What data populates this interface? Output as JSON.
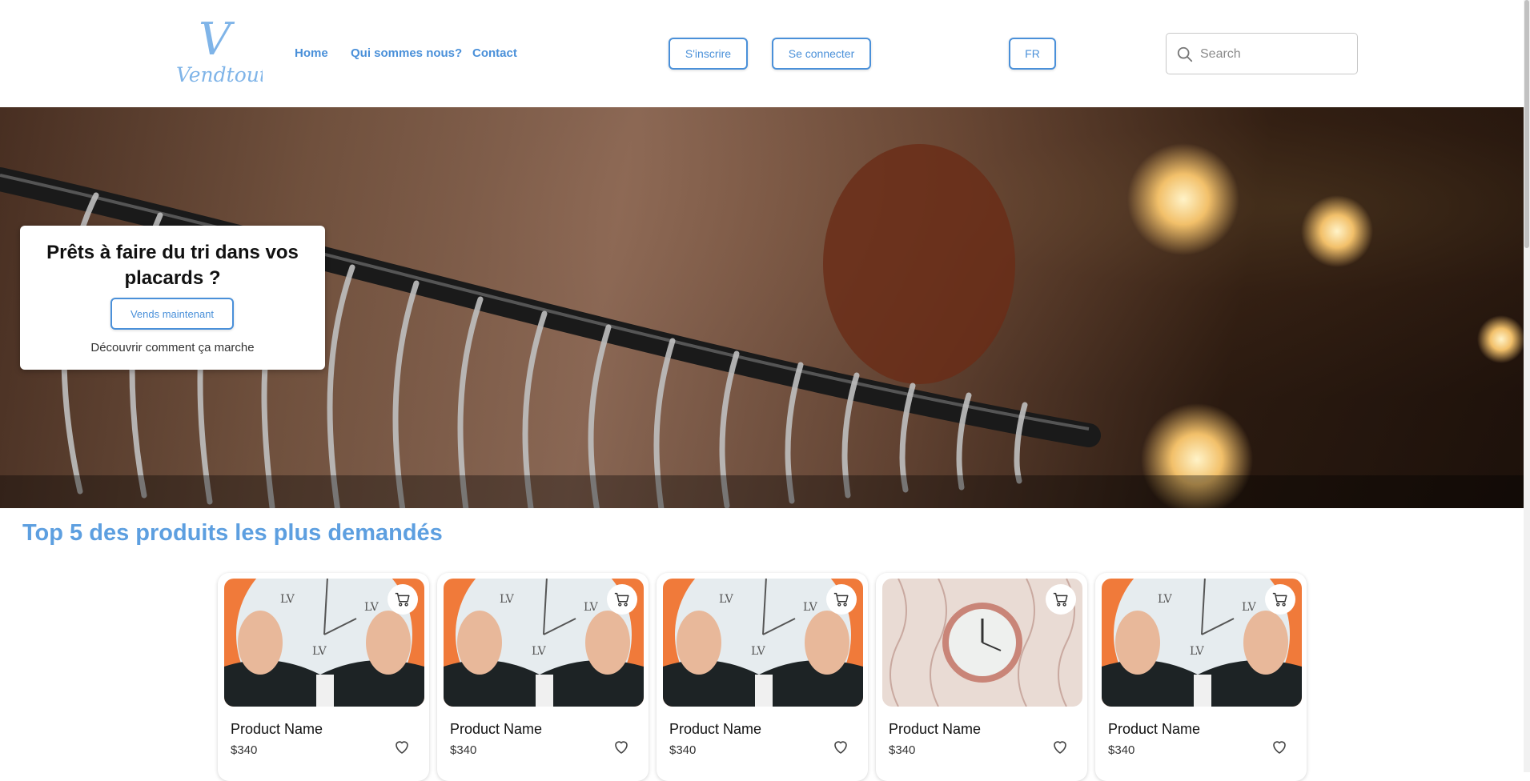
{
  "brand": {
    "logo_text": "Vendtout",
    "logo_letter": "V"
  },
  "nav": {
    "home": "Home",
    "about": "Qui sommes nous?",
    "contact": "Contact"
  },
  "auth": {
    "signup": "S'inscrire",
    "login": "Se connecter"
  },
  "language": "FR",
  "search": {
    "placeholder": "Search",
    "icon": "search-icon"
  },
  "hero": {
    "title": "Prêts à faire du tri dans vos placards ?",
    "cta": "Vends maintenant",
    "link": "Découvrir comment ça marche"
  },
  "section": {
    "title": "Top 5 des produits les plus demandés"
  },
  "products": [
    {
      "name": "Product Name",
      "price": "$340",
      "image": "clock-in-hands"
    },
    {
      "name": "Product Name",
      "price": "$340",
      "image": "clock-in-hands"
    },
    {
      "name": "Product Name",
      "price": "$340",
      "image": "clock-in-hands"
    },
    {
      "name": "Product Name",
      "price": "$340",
      "image": "wall-clock"
    },
    {
      "name": "Product Name",
      "price": "$340",
      "image": "clock-in-hands"
    }
  ],
  "colors": {
    "accent": "#4a90d9",
    "section_title": "#5d9fe0"
  }
}
